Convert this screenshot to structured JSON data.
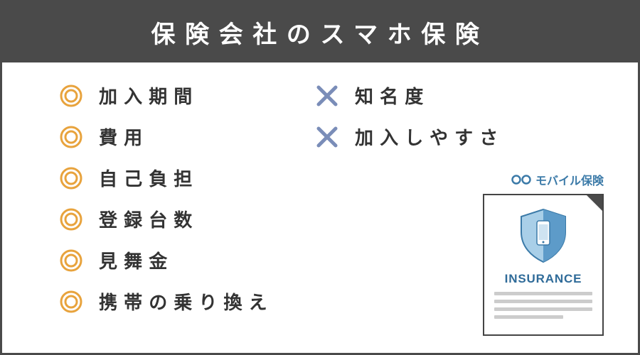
{
  "header": {
    "title": "保険会社のスマホ保険"
  },
  "pros": [
    {
      "label": "加入期間"
    },
    {
      "label": "費用"
    },
    {
      "label": "自己負担"
    },
    {
      "label": "登録台数"
    },
    {
      "label": "見舞金"
    },
    {
      "label": "携帯の乗り換え"
    }
  ],
  "cons": [
    {
      "label": "知名度"
    },
    {
      "label": "加入しやすさ"
    }
  ],
  "badge": {
    "brand": "モバイル保険",
    "card_label": "INSURANCE"
  },
  "colors": {
    "circle": "#e8a33d",
    "cross": "#7a8db8",
    "shield_light": "#a9cfe8",
    "shield_dark": "#5d9bc9",
    "brand": "#3b7aa8"
  }
}
